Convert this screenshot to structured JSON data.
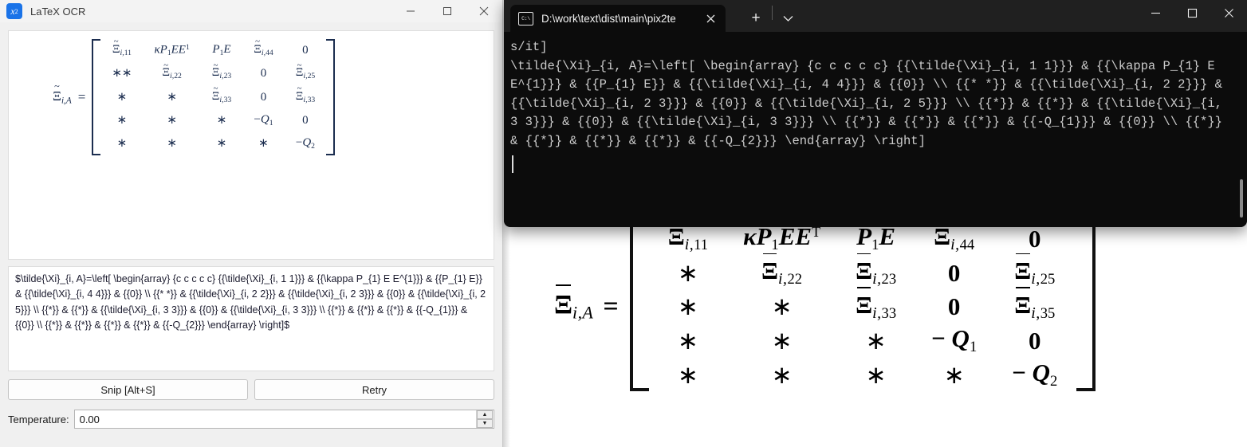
{
  "app_window": {
    "title": "LaTeX OCR",
    "icon": "x-squared-icon",
    "controls": {
      "minimize": "minimize-icon",
      "maximize": "maximize-icon",
      "close": "close-icon"
    },
    "latex_text": "$\\tilde{\\Xi}_{i, A}=\\left[ \\begin{array} {c c c c c} {{\\tilde{\\Xi}_{i, 1 1}}} & {{\\kappa P_{1} E E^{1}}} & {{P_{1} E}} & {{\\tilde{\\Xi}_{i, 4 4}}} & {{0}} \\\\ {{* *}} & {{\\tilde{\\Xi}_{i, 2 2}}} & {{\\tilde{\\Xi}_{i, 2 3}}} & {{0}} & {{\\tilde{\\Xi}_{i, 2 5}}} \\\\ {{*}} & {{*}} & {{\\tilde{\\Xi}_{i, 3 3}}} & {{0}} & {{\\tilde{\\Xi}_{i, 3 3}}} \\\\ {{*}} & {{*}} & {{*}} & {{-Q_{1}}} & {{0}} \\\\ {{*}} & {{*}} & {{*}} & {{*}} & {{-Q_{2}}} \\end{array} \\right]$",
    "buttons": {
      "snip": "Snip [Alt+S]",
      "retry": "Retry"
    },
    "temperature": {
      "label": "Temperature:",
      "value": "0.00"
    },
    "preview_matrix": {
      "lhs": "Ξ̃i,A",
      "equals": "=",
      "rows": [
        [
          "Ξ̃i,11",
          "κP1EE¹",
          "P1E",
          "Ξ̃i,44",
          "0"
        ],
        [
          "**",
          "Ξ̃i,22",
          "Ξ̃i,23",
          "0",
          "Ξ̃i,25"
        ],
        [
          "*",
          "*",
          "Ξ̃i,33",
          "0",
          "Ξ̃i,33"
        ],
        [
          "*",
          "*",
          "*",
          "−Q1",
          "0"
        ],
        [
          "*",
          "*",
          "*",
          "*",
          "−Q2"
        ]
      ]
    }
  },
  "terminal": {
    "tab": {
      "title": "D:\\work\\text\\dist\\main\\pix2te",
      "icon": "command-prompt-icon",
      "close": "close-icon"
    },
    "new_tab": "+",
    "dropdown": "chevron-down-icon",
    "controls": {
      "minimize": "minimize-icon",
      "maximize": "maximize-icon",
      "close": "close-icon"
    },
    "output": "s/it]\n\\tilde{\\Xi}_{i, A}=\\left[ \\begin{array} {c c c c c} {{\\tilde{\\Xi}_{i, 1 1}}} & {{\\kappa P_{1} E E^{1}}} & {{P_{1} E}} & {{\\tilde{\\Xi}_{i, 4 4}}} & {{0}} \\\\ {{* *}} & {{\\tilde{\\Xi}_{i, 2 2}}} & {{\\tilde{\\Xi}_{i, 2 3}}} & {{0}} & {{\\tilde{\\Xi}_{i, 2 5}}} \\\\ {{*}} & {{*}} & {{\\tilde{\\Xi}_{i, 3 3}}} & {{0}} & {{\\tilde{\\Xi}_{i, 3 3}}} \\\\ {{*}} & {{*}} & {{*}} & {{-Q_{1}}} & {{0}} \\\\ {{*}} & {{*}} & {{*}} & {{*}} & {{-Q_{2}}} \\end{array} \\right]"
  },
  "background_document": {
    "lhs": "Ξ̄i,A",
    "equals": "=",
    "rows": [
      [
        "Ξ̄i,11",
        "κP1EEᵀ",
        "P1E",
        "Ξ̄i,44",
        "0"
      ],
      [
        "*",
        "Ξ̄i,22",
        "Ξ̄i,23",
        "0",
        "Ξ̄i,25"
      ],
      [
        "*",
        "*",
        "Ξ̄i,33",
        "0",
        "Ξ̄i,35"
      ],
      [
        "*",
        "*",
        "*",
        "− Q1",
        "0"
      ],
      [
        "*",
        "*",
        "*",
        "*",
        "− Q2"
      ]
    ]
  },
  "colors": {
    "accent": "#1a73e8",
    "terminal_bg": "#0c0c0c",
    "terminal_chrome": "#202020",
    "app_bg": "#f0f0f0",
    "math_ink": "#1b2d4f"
  }
}
